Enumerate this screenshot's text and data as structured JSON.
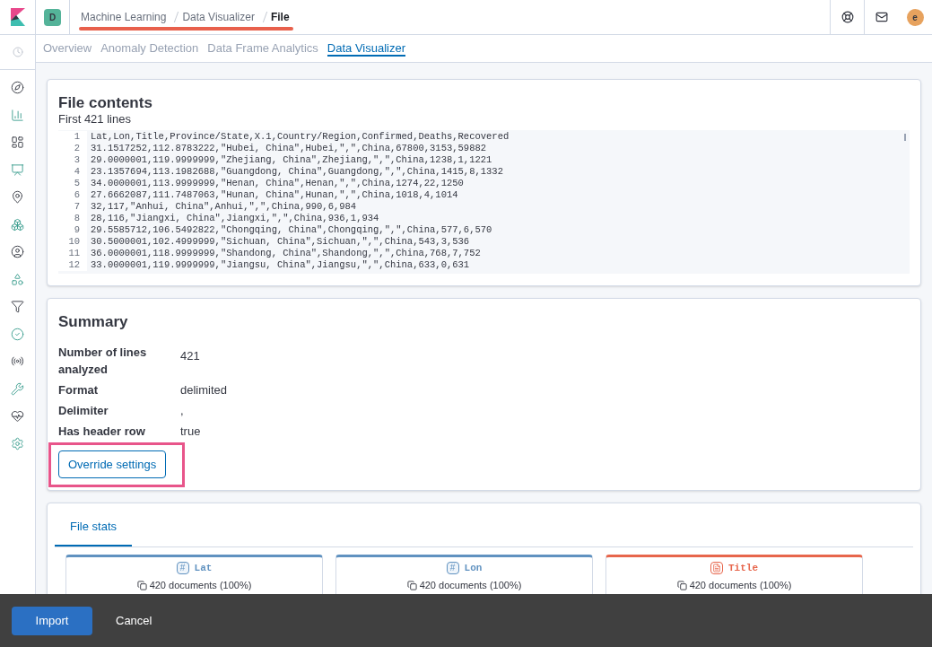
{
  "header": {
    "space_badge": "D",
    "breadcrumbs": [
      {
        "label": "Machine Learning",
        "current": false
      },
      {
        "label": "Data Visualizer",
        "current": false
      },
      {
        "label": "File",
        "current": true
      }
    ],
    "avatar": "e"
  },
  "tabs": [
    {
      "label": "Overview",
      "selected": false
    },
    {
      "label": "Anomaly Detection",
      "selected": false
    },
    {
      "label": "Data Frame Analytics",
      "selected": false
    },
    {
      "label": "Data Visualizer",
      "selected": true
    }
  ],
  "file_contents": {
    "title": "File contents",
    "subtitle": "First 421 lines",
    "lines": [
      {
        "number": "1",
        "text": "Lat,Lon,Title,Province/State,X.1,Country/Region,Confirmed,Deaths,Recovered"
      },
      {
        "number": "2",
        "text": "31.1517252,112.8783222,\"Hubei, China\",Hubei,\",\",China,67800,3153,59882"
      },
      {
        "number": "3",
        "text": "29.0000001,119.9999999,\"Zhejiang, China\",Zhejiang,\",\",China,1238,1,1221"
      },
      {
        "number": "4",
        "text": "23.1357694,113.1982688,\"Guangdong, China\",Guangdong,\",\",China,1415,8,1332"
      },
      {
        "number": "5",
        "text": "34.0000001,113.9999999,\"Henan, China\",Henan,\",\",China,1274,22,1250"
      },
      {
        "number": "6",
        "text": "27.6662087,111.7487063,\"Hunan, China\",Hunan,\",\",China,1018,4,1014"
      },
      {
        "number": "7",
        "text": "32,117,\"Anhui, China\",Anhui,\",\",China,990,6,984"
      },
      {
        "number": "8",
        "text": "28,116,\"Jiangxi, China\",Jiangxi,\",\",China,936,1,934"
      },
      {
        "number": "9",
        "text": "29.5585712,106.5492822,\"Chongqing, China\",Chongqing,\",\",China,577,6,570"
      },
      {
        "number": "10",
        "text": "30.5000001,102.4999999,\"Sichuan, China\",Sichuan,\",\",China,543,3,536"
      },
      {
        "number": "11",
        "text": "36.0000001,118.9999999,\"Shandong, China\",Shandong,\",\",China,768,7,752"
      },
      {
        "number": "12",
        "text": "33.0000001,119.9999999,\"Jiangsu, China\",Jiangsu,\",\",China,633,0,631"
      }
    ]
  },
  "summary": {
    "title": "Summary",
    "rows": [
      {
        "label": "Number of lines analyzed",
        "value": "421"
      },
      {
        "label": "Format",
        "value": "delimited"
      },
      {
        "label": "Delimiter",
        "value": ","
      },
      {
        "label": "Has header row",
        "value": "true"
      }
    ],
    "button": "Override settings"
  },
  "file_stats": {
    "tabs": [
      {
        "label": "File stats",
        "selected": true
      }
    ],
    "fields": [
      {
        "kind": "number",
        "type_icon": "#",
        "name": "Lat",
        "count": "420 documents (100%)"
      },
      {
        "kind": "number",
        "type_icon": "#",
        "name": "Lon",
        "count": "420 documents (100%)"
      },
      {
        "kind": "text",
        "name": "Title",
        "count": "420 documents (100%)"
      }
    ]
  },
  "footer": {
    "buttons": [
      {
        "label": "Import",
        "kind": "primary"
      },
      {
        "label": "Cancel",
        "kind": "plain"
      }
    ]
  }
}
